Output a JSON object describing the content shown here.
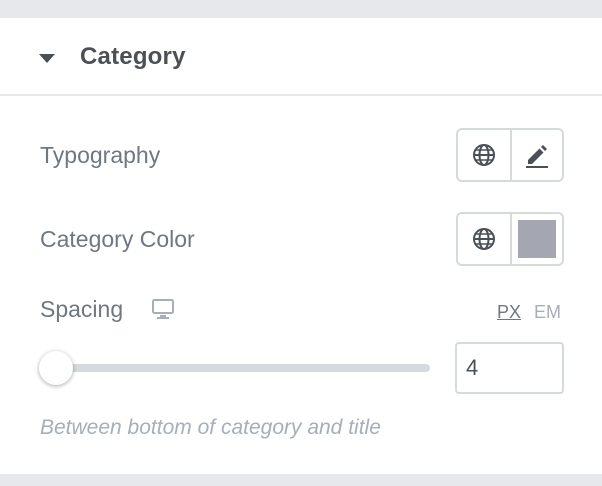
{
  "section": {
    "title": "Category",
    "expanded": true
  },
  "controls": {
    "typography": {
      "label": "Typography",
      "global_icon": "globe-icon",
      "edit_icon": "pencil-icon"
    },
    "category_color": {
      "label": "Category Color",
      "global_icon": "globe-icon",
      "swatch_color": "#a4a7b2"
    },
    "spacing": {
      "label": "Spacing",
      "device_icon": "desktop-icon",
      "units": [
        "PX",
        "EM"
      ],
      "active_unit": "PX",
      "value": "4",
      "description": "Between bottom of category and title"
    }
  },
  "colors": {
    "label_text": "#6d7882",
    "heading_text": "#495157",
    "border": "#d5dadf",
    "muted_text": "#a4afb7"
  }
}
